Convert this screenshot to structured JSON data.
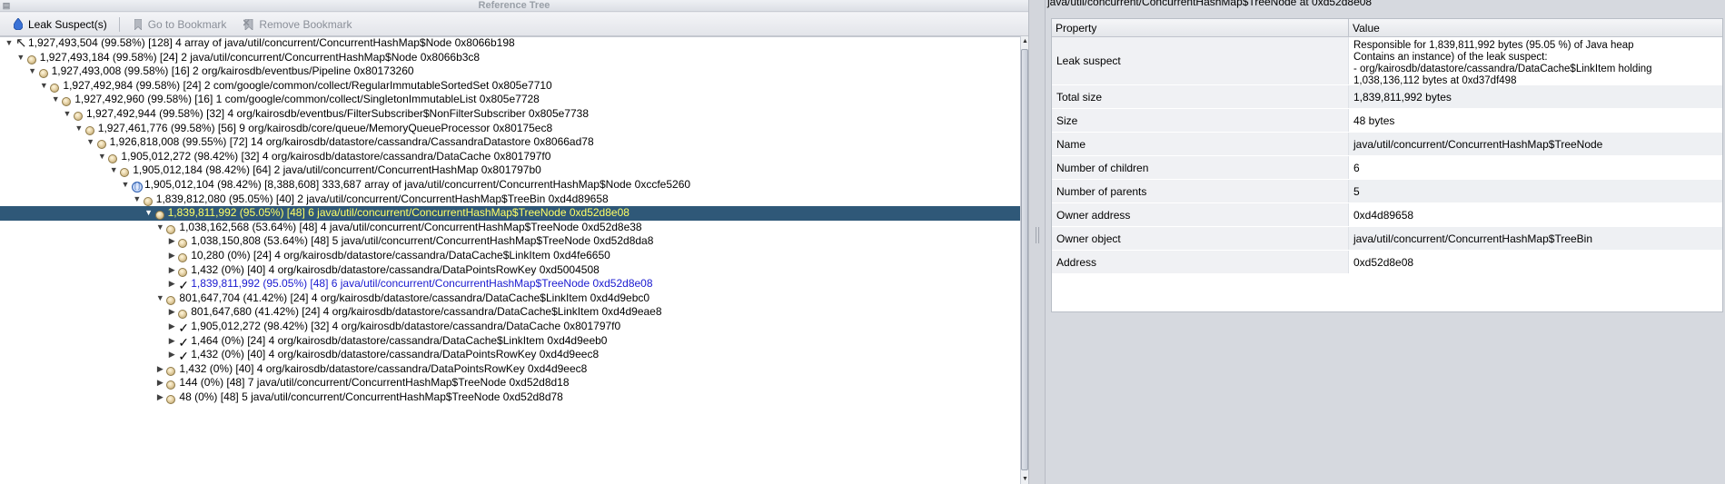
{
  "left_pane": {
    "title": "Reference Tree",
    "toolbar": {
      "leak_suspects": "Leak Suspect(s)",
      "go_to_bookmark": "Go to Bookmark",
      "remove_bookmark": "Remove Bookmark"
    },
    "tree_rows": [
      {
        "depth": 0,
        "twisty": "expanded",
        "icon": "root-arrow",
        "text": "1,927,493,504 (99.58%) [128] 4 array of java/util/concurrent/ConcurrentHashMap$Node 0x8066b198"
      },
      {
        "depth": 1,
        "twisty": "expanded",
        "icon": "object",
        "text": "1,927,493,184 (99.58%) [24] 2 java/util/concurrent/ConcurrentHashMap$Node 0x8066b3c8"
      },
      {
        "depth": 2,
        "twisty": "expanded",
        "icon": "object",
        "text": "1,927,493,008 (99.58%) [16] 2 org/kairosdb/eventbus/Pipeline 0x80173260"
      },
      {
        "depth": 3,
        "twisty": "expanded",
        "icon": "object",
        "text": "1,927,492,984 (99.58%) [24] 2 com/google/common/collect/RegularImmutableSortedSet 0x805e7710"
      },
      {
        "depth": 4,
        "twisty": "expanded",
        "icon": "object",
        "text": "1,927,492,960 (99.58%) [16] 1 com/google/common/collect/SingletonImmutableList 0x805e7728"
      },
      {
        "depth": 5,
        "twisty": "expanded",
        "icon": "object",
        "text": "1,927,492,944 (99.58%) [32] 4 org/kairosdb/eventbus/FilterSubscriber$NonFilterSubscriber 0x805e7738"
      },
      {
        "depth": 6,
        "twisty": "expanded",
        "icon": "object",
        "text": "1,927,461,776 (99.58%) [56] 9 org/kairosdb/core/queue/MemoryQueueProcessor 0x80175ec8"
      },
      {
        "depth": 7,
        "twisty": "expanded",
        "icon": "object",
        "text": "1,926,818,008 (99.55%) [72] 14 org/kairosdb/datastore/cassandra/CassandraDatastore 0x8066ad78"
      },
      {
        "depth": 8,
        "twisty": "expanded",
        "icon": "object",
        "text": "1,905,012,272 (98.42%) [32] 4 org/kairosdb/datastore/cassandra/DataCache 0x801797f0"
      },
      {
        "depth": 9,
        "twisty": "expanded",
        "icon": "object",
        "text": "1,905,012,184 (98.42%) [64] 2 java/util/concurrent/ConcurrentHashMap 0x801797b0"
      },
      {
        "depth": 10,
        "twisty": "expanded",
        "icon": "array",
        "text": "1,905,012,104 (98.42%) [8,388,608] 333,687 array of java/util/concurrent/ConcurrentHashMap$Node 0xccfe5260"
      },
      {
        "depth": 11,
        "twisty": "expanded",
        "icon": "object",
        "text": "1,839,812,080 (95.05%) [40] 2 java/util/concurrent/ConcurrentHashMap$TreeBin 0xd4d89658"
      },
      {
        "depth": 12,
        "twisty": "expanded",
        "icon": "object",
        "text": "1,839,811,992 (95.05%) [48] 6 java/util/concurrent/ConcurrentHashMap$TreeNode 0xd52d8e08",
        "style": "selected"
      },
      {
        "depth": 13,
        "twisty": "expanded",
        "icon": "object",
        "text": "1,038,162,568 (53.64%) [48] 4 java/util/concurrent/ConcurrentHashMap$TreeNode 0xd52d8e38"
      },
      {
        "depth": 14,
        "twisty": "collapsed",
        "icon": "object",
        "text": "1,038,150,808 (53.64%) [48] 5 java/util/concurrent/ConcurrentHashMap$TreeNode 0xd52d8da8"
      },
      {
        "depth": 14,
        "twisty": "collapsed",
        "icon": "object",
        "text": "10,280 (0%) [24] 4 org/kairosdb/datastore/cassandra/DataCache$LinkItem 0xd4fe6650"
      },
      {
        "depth": 14,
        "twisty": "collapsed",
        "icon": "object",
        "text": "1,432 (0%) [40] 4 org/kairosdb/datastore/cassandra/DataPointsRowKey 0xd5004508"
      },
      {
        "depth": 14,
        "twisty": "collapsed",
        "icon": "check",
        "text": "1,839,811,992 (95.05%) [48] 6 java/util/concurrent/ConcurrentHashMap$TreeNode 0xd52d8e08",
        "style": "blue"
      },
      {
        "depth": 13,
        "twisty": "expanded",
        "icon": "object",
        "text": "801,647,704 (41.42%) [24] 4 org/kairosdb/datastore/cassandra/DataCache$LinkItem 0xd4d9ebc0"
      },
      {
        "depth": 14,
        "twisty": "collapsed",
        "icon": "object",
        "text": "801,647,680 (41.42%) [24] 4 org/kairosdb/datastore/cassandra/DataCache$LinkItem 0xd4d9eae8"
      },
      {
        "depth": 14,
        "twisty": "collapsed",
        "icon": "check",
        "text": "1,905,012,272 (98.42%) [32] 4 org/kairosdb/datastore/cassandra/DataCache 0x801797f0"
      },
      {
        "depth": 14,
        "twisty": "collapsed",
        "icon": "check",
        "text": "1,464 (0%) [24] 4 org/kairosdb/datastore/cassandra/DataCache$LinkItem 0xd4d9eeb0"
      },
      {
        "depth": 14,
        "twisty": "collapsed",
        "icon": "check",
        "text": "1,432 (0%) [40] 4 org/kairosdb/datastore/cassandra/DataPointsRowKey 0xd4d9eec8"
      },
      {
        "depth": 13,
        "twisty": "collapsed",
        "icon": "object",
        "text": "1,432 (0%) [40] 4 org/kairosdb/datastore/cassandra/DataPointsRowKey 0xd4d9eec8"
      },
      {
        "depth": 13,
        "twisty": "collapsed",
        "icon": "object",
        "text": "144 (0%) [48] 7 java/util/concurrent/ConcurrentHashMap$TreeNode 0xd52d8d18"
      },
      {
        "depth": 13,
        "twisty": "collapsed",
        "icon": "object",
        "text": "48 (0%) [48] 5 java/util/concurrent/ConcurrentHashMap$TreeNode 0xd52d8d78"
      }
    ]
  },
  "right_pane": {
    "title": "java/util/concurrent/ConcurrentHashMap$TreeNode at 0xd52d8e08",
    "columns": {
      "property": "Property",
      "value": "Value"
    },
    "leak_suspect": {
      "key": "Leak suspect",
      "lines": [
        "Responsible for 1,839,811,992 bytes (95.05 %) of Java heap",
        "Contains an instance) of the leak suspect:",
        "- org/kairosdb/datastore/cassandra/DataCache$LinkItem holding",
        "1,038,136,112 bytes at 0xd37df498"
      ]
    },
    "rows": [
      {
        "key": "Total size",
        "value": "1,839,811,992 bytes"
      },
      {
        "key": "Size",
        "value": "48 bytes"
      },
      {
        "key": "Name",
        "value": "java/util/concurrent/ConcurrentHashMap$TreeNode"
      },
      {
        "key": "Number of children",
        "value": "6"
      },
      {
        "key": "Number of parents",
        "value": "5"
      },
      {
        "key": "Owner address",
        "value": "0xd4d89658"
      },
      {
        "key": "Owner object",
        "value": "java/util/concurrent/ConcurrentHashMap$TreeBin"
      },
      {
        "key": "Address",
        "value": "0xd52d8e08"
      }
    ]
  },
  "colors": {
    "selection_bg": "#2f5878",
    "selection_fg": "#ffff66",
    "link_blue": "#1a1ad0"
  }
}
